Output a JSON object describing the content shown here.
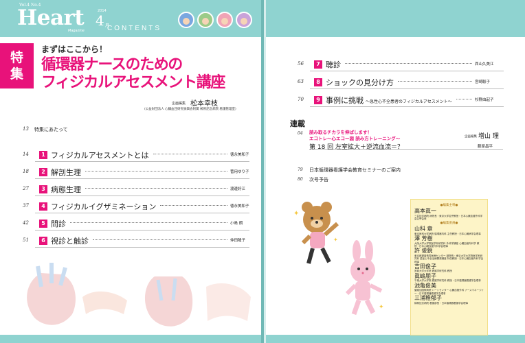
{
  "header": {
    "vol": "Vol.4 No.4",
    "logo": "Heart",
    "logo_sub": "Magazine",
    "issue_year": "2014",
    "issue_number": "4",
    "issue_month": "月",
    "contents_word": "CONTENTS",
    "face_colors": [
      "#7aa7e0",
      "#9ccb88",
      "#f0a4b6",
      "#c9a3d9"
    ]
  },
  "feature": {
    "tag": "特集",
    "lead": "まずはここから！",
    "title_line1": "循環器ナースのための",
    "title_line2": "フィジカルアセスメント講座",
    "editor_role": "企画編集",
    "editor_name": "松本幸枝",
    "editor_affiliation": "(公益財団法人 心臓血圧研究振興会附属 榊原記念病院 看護管理室)",
    "intro_page": "13",
    "intro_label": "特集にあたって"
  },
  "toc_left": [
    {
      "page": "14",
      "num": "1",
      "title": "フィジカルアセスメントとは",
      "author": "徳永美和子"
    },
    {
      "page": "18",
      "num": "2",
      "title": "解剖生理",
      "author": "菅用ゆり子"
    },
    {
      "page": "27",
      "num": "3",
      "title": "病態生理",
      "author": "渡邊好江"
    },
    {
      "page": "37",
      "num": "4",
      "title": "フィジカルイグザミネーション",
      "author": "徳永美和子"
    },
    {
      "page": "42",
      "num": "5",
      "title": "問診",
      "author": "小島 朗"
    },
    {
      "page": "51",
      "num": "6",
      "title": "視診と触診",
      "author": "仲田隆子"
    }
  ],
  "toc_right": [
    {
      "page": "56",
      "num": "7",
      "title": "聴診",
      "subtitle": "",
      "author": "西山久美江"
    },
    {
      "page": "63",
      "num": "8",
      "title": "ショックの見分け方",
      "subtitle": "",
      "author": "宮崎聡子"
    },
    {
      "page": "70",
      "num": "9",
      "title": "事例に挑戦",
      "subtitle": "～急性心不全患者のフィジカルアセスメント～",
      "author": "杉野由起子"
    }
  ],
  "serial": {
    "heading": "連載",
    "page": "04",
    "kicker1": "読み取るチカラを伸ばします！",
    "kicker2": "エコトレ～心エコー図 読み方トレーニング～",
    "editor_role": "企画編集",
    "editor_name": "増山 理",
    "episode": "第 18 回  左室拡大＋逆流血流＝？",
    "episode_author": "藤原昌平"
  },
  "misc": [
    {
      "page": "79",
      "label": "日本循環器看護学会教育セミナーのご案内"
    },
    {
      "page": "80",
      "label": "次号予告"
    }
  ],
  "board": {
    "head1": "●編集主幹●",
    "head2": "●編集委員●",
    "chief": [
      {
        "name": "高本眞一",
        "aff": "三井記念病院 病院長・東京大学名誉教授・日本心臓血管外科学会名誉会長"
      }
    ],
    "members": [
      {
        "name": "山科 章",
        "aff": "東京医科大学病院 循環器内科 主任教授・日本心臓病学会理事"
      },
      {
        "name": "澤 芳樹",
        "aff": "大阪大学大学院医学系研究科 外科学講座 心臓血管外科学 教授・日本心臓血管外科学会理事"
      },
      {
        "name": "許 俊鋭",
        "aff": "東京都健康長寿医療センター 副院長・東京大学大学院医学系研究科 重症心不全治療開発講座 特任教授・日本心臓血管外科学会理事"
      },
      {
        "name": "吉田俊子",
        "aff": "宮城大学大学院 看護学研究科 教授"
      },
      {
        "name": "眞嶋朋子",
        "aff": "千葉大学大学院 看護学研究科 教授・日本循環器看護学会理事"
      },
      {
        "name": "池亀俊美",
        "aff": "聖路加国際病院 ハートセンター 心臓血管外科 ナースマネージャー・日本循環器看護学会理事"
      },
      {
        "name": "三浦稚郁子",
        "aff": "榊原記念病院 看護部長・日本循環器看護学会理事"
      }
    ]
  },
  "colors": {
    "accent": "#e8127a",
    "band": "#8fd3d0"
  }
}
